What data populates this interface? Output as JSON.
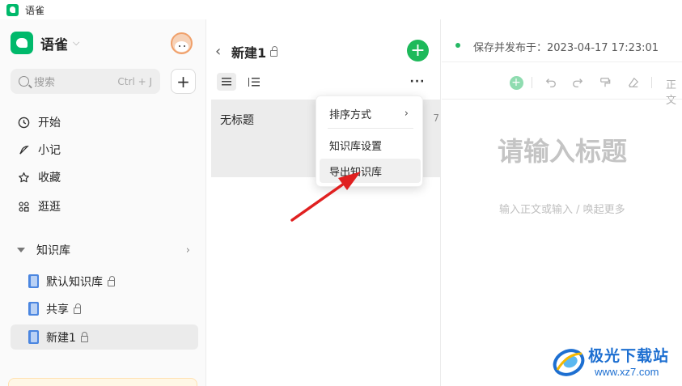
{
  "window": {
    "title": "语雀"
  },
  "sidebar": {
    "brand_name": "语雀",
    "search": {
      "placeholder": "搜索",
      "shortcut": "Ctrl + J"
    },
    "nav": [
      {
        "label": "开始",
        "icon": "clock-icon"
      },
      {
        "label": "小记",
        "icon": "feather-icon"
      },
      {
        "label": "收藏",
        "icon": "star-icon"
      },
      {
        "label": "逛逛",
        "icon": "grid-icon"
      }
    ],
    "knowledge_base_header": "知识库",
    "books": [
      {
        "label": "默认知识库",
        "locked": true,
        "active": false
      },
      {
        "label": "共享",
        "locked": true,
        "active": false
      },
      {
        "label": "新建1",
        "locked": true,
        "active": true
      }
    ]
  },
  "middle": {
    "title": "新建1",
    "documents": [
      {
        "title": "无标题",
        "date_fragment": "7"
      }
    ]
  },
  "menu": {
    "items": [
      {
        "label": "排序方式",
        "has_submenu": true
      },
      {
        "label": "知识库设置",
        "has_submenu": false
      },
      {
        "label": "导出知识库",
        "has_submenu": false,
        "hovered": true
      }
    ]
  },
  "editor": {
    "status": "保存并发布于：2023-04-17 17:23:01",
    "toolbar_text": "正文",
    "title_placeholder": "请输入标题",
    "body_placeholder": "输入正文或输入 / 唤起更多"
  },
  "watermark": {
    "name": "极光下载站",
    "url": "www.xz7.com"
  },
  "colors": {
    "accent": "#00b96b",
    "annotation_arrow": "#e02020",
    "watermark": "#1d6fd1"
  }
}
